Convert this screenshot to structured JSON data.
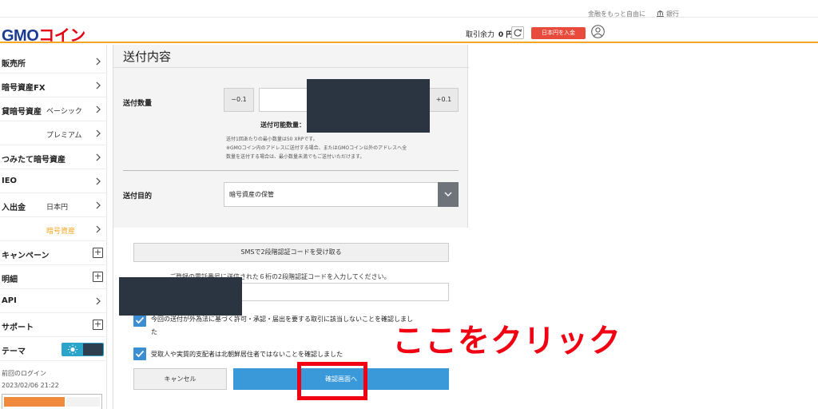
{
  "topbar": {
    "tagline": "金融をもっと自由に",
    "bank_link": "銀行"
  },
  "header": {
    "logo_main": "GMO",
    "logo_accent": "コイン",
    "balance_label": "取引余力",
    "balance_value": "0 円",
    "deposit_button": "日本円を入金",
    "icons": [
      "refresh-icon",
      "user-icon",
      "bank-icon"
    ]
  },
  "sidebar": {
    "items": [
      {
        "label": "販売所"
      },
      {
        "label": "暗号資産FX"
      },
      {
        "label": "貸暗号資産",
        "sub": "ベーシック"
      },
      {
        "sub": "プレミアム"
      },
      {
        "label": "つみたて暗号資産"
      },
      {
        "label": "IEO"
      },
      {
        "label": "入出金",
        "sub": "日本円"
      },
      {
        "sub": "暗号資産"
      },
      {
        "label": "キャンペーン"
      },
      {
        "label": "明細"
      },
      {
        "label": "API"
      },
      {
        "label": "サポート"
      },
      {
        "label": "テーマ"
      }
    ],
    "last_login_label": "前回のログイン",
    "last_login_time": "2023/02/06 21:22"
  },
  "form": {
    "title": "送付内容",
    "amount_label": "送付数量",
    "minus_label": "−0.1",
    "plus_label": "+0.1",
    "available_label": "送付可能数量：",
    "notes": [
      "送付1回あたりの最小数量は50 XRPです。",
      "※GMOコイン内のアドレスに送付する場合、またはGMOコイン以外のアドレスへ全",
      "数量を送付する場合は、最小数量未満でもご送付いただけます。"
    ],
    "purpose_label": "送付目的",
    "purpose_value": "暗号資産の保管",
    "sms_button": "SMSで2段階認証コードを受け取る",
    "sms_description": "ご登録の電話番号に送信された６桁の2段階認証コードを入力してください。",
    "check1_line1": "今回の送付が外為法に基づく許可・承認・届出を要する取引に該当しないことを確認しまし",
    "check1_line2": "た",
    "check2": "受取人や実質的支配者は北朝鮮居住者ではないことを確認しました",
    "cancel_button": "キャンセル",
    "confirm_button": "確認画面へ"
  },
  "annotation": {
    "text": "ここをクリック",
    "color": "#f00012"
  },
  "colors": {
    "accent_orange": "#f5a623",
    "brand_blue": "#1a3b8f",
    "confirm_blue": "#3a9ad9",
    "deposit_red": "#e84a3b"
  }
}
